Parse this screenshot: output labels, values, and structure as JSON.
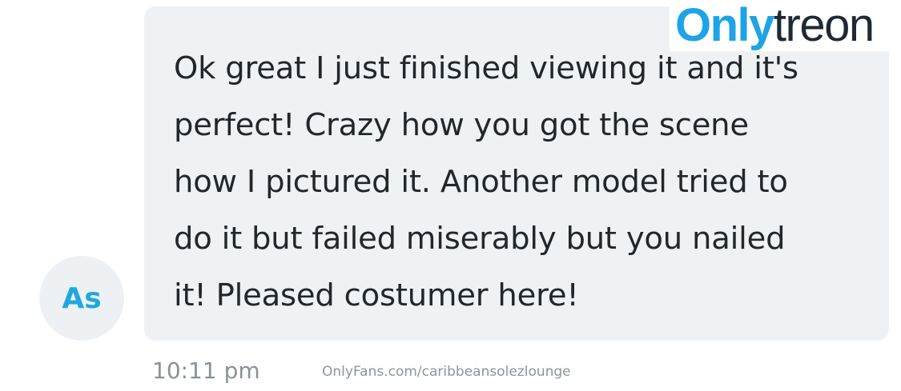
{
  "message": {
    "lines": [
      "Ok great I just finished viewing it and it's",
      "perfect! Crazy how you got the scene",
      "how I pictured it. Another model tried to",
      "do it but failed miserably but you nailed",
      "it! Pleased costumer here!"
    ],
    "timestamp": "10:11 pm"
  },
  "avatar": {
    "initials": "As"
  },
  "watermark": {
    "url": "OnlyFans.com/caribbeansolezlounge",
    "brand_part1": "Only",
    "brand_part2": "treon"
  },
  "colors": {
    "accent": "#1ca4e6",
    "bubble": "#eff2f4",
    "text": "#22272b",
    "muted": "#8a9298"
  }
}
